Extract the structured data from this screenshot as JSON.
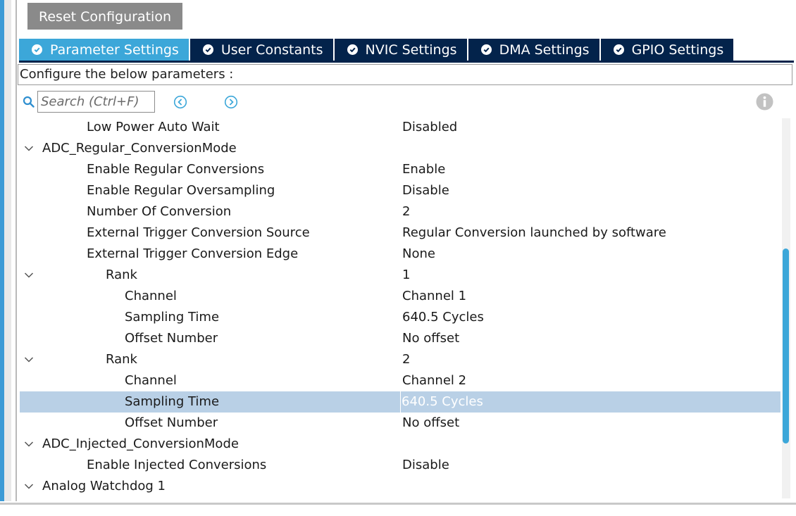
{
  "toolbar": {
    "reset_label": "Reset Configuration"
  },
  "tabs": [
    {
      "label": "Parameter Settings",
      "active": true
    },
    {
      "label": "User Constants",
      "active": false
    },
    {
      "label": "NVIC Settings",
      "active": false
    },
    {
      "label": "DMA Settings",
      "active": false
    },
    {
      "label": "GPIO Settings",
      "active": false
    }
  ],
  "panel": {
    "config_label": "Configure the below parameters :",
    "search_placeholder": "Search (Ctrl+F)"
  },
  "tree": {
    "rows": [
      {
        "name": "Low Power Auto Wait",
        "value": "Disabled"
      },
      {
        "name": "ADC_Regular_ConversionMode",
        "value": ""
      },
      {
        "name": "Enable Regular Conversions",
        "value": "Enable"
      },
      {
        "name": "Enable Regular Oversampling",
        "value": "Disable"
      },
      {
        "name": "Number Of Conversion",
        "value": "2"
      },
      {
        "name": "External Trigger Conversion Source",
        "value": "Regular Conversion launched by software"
      },
      {
        "name": "External Trigger Conversion Edge",
        "value": "None"
      },
      {
        "name": "Rank",
        "value": "1"
      },
      {
        "name": "Channel",
        "value": "Channel 1"
      },
      {
        "name": "Sampling Time",
        "value": "640.5 Cycles"
      },
      {
        "name": "Offset Number",
        "value": "No offset"
      },
      {
        "name": "Rank",
        "value": "2"
      },
      {
        "name": "Channel",
        "value": "Channel 2"
      },
      {
        "name": "Sampling Time",
        "value": "640.5 Cycles"
      },
      {
        "name": "Offset Number",
        "value": "No offset"
      },
      {
        "name": "ADC_Injected_ConversionMode",
        "value": ""
      },
      {
        "name": "Enable Injected Conversions",
        "value": "Disable"
      },
      {
        "name": "Analog Watchdog 1",
        "value": ""
      }
    ]
  },
  "colors": {
    "tab_active": "#3ca7d9",
    "tab_inactive": "#03234b",
    "selection": "#b9d0e6",
    "button_gray": "#8a8a8a"
  },
  "icons": [
    "check-circle-icon",
    "search-icon",
    "prev-result-icon",
    "next-result-icon",
    "info-icon",
    "chevron-down-icon"
  ]
}
